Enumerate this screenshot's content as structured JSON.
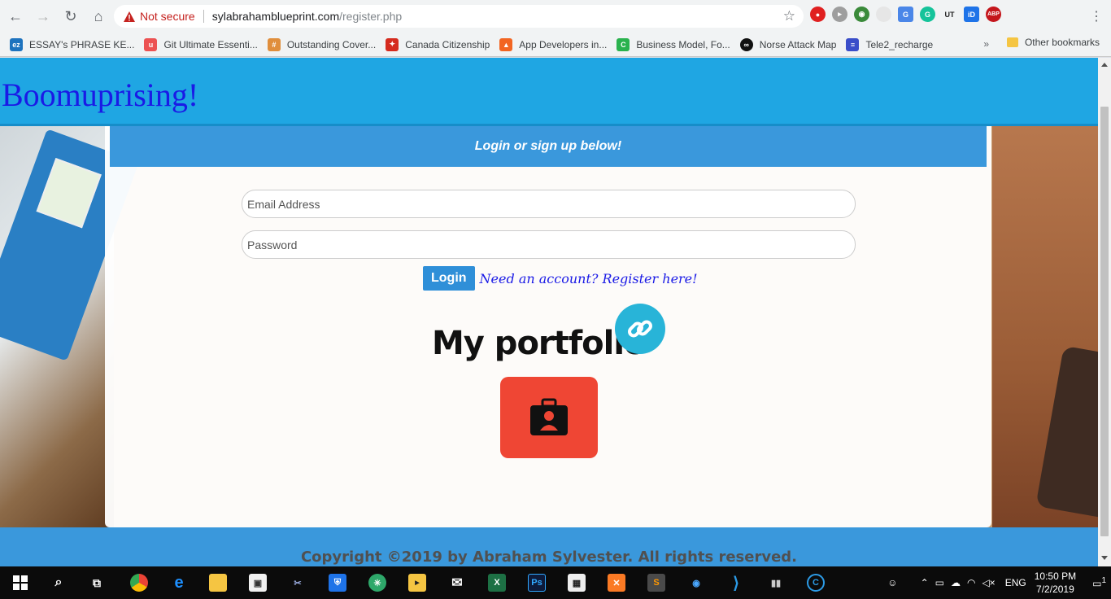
{
  "browser": {
    "security_label": "Not secure",
    "url_host": "sylabrahamblueprint.com",
    "url_path": "/register.php",
    "bookmarks": [
      {
        "label": "ESSAY's PHRASE KE...",
        "icon": "ez-icon",
        "color": "#1e73be",
        "glyph": "ez"
      },
      {
        "label": "Git Ultimate Essenti...",
        "icon": "udemy-icon",
        "color": "#ec5252",
        "glyph": "u"
      },
      {
        "label": "Outstanding Cover...",
        "icon": "ladder-icon",
        "color": "#e08e3c",
        "glyph": "#"
      },
      {
        "label": "Canada Citizenship",
        "icon": "maple-leaf-icon",
        "color": "#d52b1e",
        "glyph": "✦"
      },
      {
        "label": "App Developers in...",
        "icon": "app-dev-icon",
        "color": "#f26522",
        "glyph": "▲"
      },
      {
        "label": "Business Model, Fo...",
        "icon": "c-icon",
        "color": "#2ab24e",
        "glyph": "C"
      },
      {
        "label": "Norse Attack Map",
        "icon": "norse-icon",
        "color": "#111111",
        "glyph": "∞"
      },
      {
        "label": "Tele2_recharge",
        "icon": "flag-icon",
        "color": "#3a4ec9",
        "glyph": "≡"
      }
    ],
    "more_bookmarks": "»",
    "other_bookmarks": "Other bookmarks"
  },
  "site": {
    "brand": "Boomuprising!",
    "card_heading": "Login or sign up below!",
    "email_placeholder": "Email Address",
    "password_placeholder": "Password",
    "login_label": "Login",
    "register_link": "Need an account? Register here!",
    "portfolio_title": "My portfolio",
    "copyright": "Copyright ©2019 by Abraham Sylvester. All rights reserved."
  },
  "taskbar": {
    "language": "ENG",
    "time": "10:50 PM",
    "date": "7/2/2019",
    "notification_count": "1"
  },
  "colors": {
    "header_blue": "#1fa6e3",
    "card_head_blue": "#3a98dc",
    "portfolio_red": "#ef4634",
    "link_teal": "#28b4d8"
  }
}
